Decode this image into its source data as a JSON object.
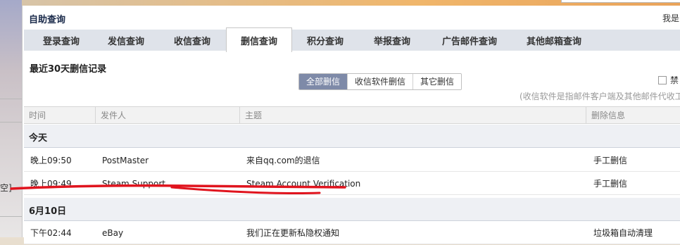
{
  "background": {
    "left_edge_text": "空]"
  },
  "panel": {
    "title": "自助查询",
    "right_note": "我是"
  },
  "tabs": [
    {
      "label": "登录查询",
      "active": false
    },
    {
      "label": "发信查询",
      "active": false
    },
    {
      "label": "收信查询",
      "active": false
    },
    {
      "label": "删信查询",
      "active": true
    },
    {
      "label": "积分查询",
      "active": false
    },
    {
      "label": "举报查询",
      "active": false
    },
    {
      "label": "广告邮件查询",
      "active": false
    },
    {
      "label": "其他邮箱查询",
      "active": false
    }
  ],
  "section": {
    "title": "最近30天删信记录"
  },
  "filters": {
    "buttons": [
      {
        "label": "全部删信",
        "active": true
      },
      {
        "label": "收信软件删信",
        "active": false
      },
      {
        "label": "其它删信",
        "active": false
      }
    ],
    "checkbox_label": "禁",
    "hint": "(收信软件是指邮件客户端及其他邮件代收工"
  },
  "table": {
    "columns": [
      "时间",
      "发件人",
      "主题",
      "删除信息"
    ],
    "groups": [
      {
        "label": "今天",
        "rows": [
          {
            "time": "晚上09:50",
            "sender": "PostMaster",
            "subject": "来自qq.com的退信",
            "info": "手工删信"
          },
          {
            "time": "晚上09:49",
            "sender": "Steam Support",
            "subject": "Steam Account Verification",
            "info": "手工删信"
          }
        ]
      },
      {
        "label": "6月10日",
        "rows": [
          {
            "time": "下午02:44",
            "sender": "eBay",
            "subject": "我们正在更新私隐权通知",
            "info": "垃圾箱自动清理"
          }
        ]
      }
    ]
  },
  "colors": {
    "accent": "#7e8aa8",
    "annotation_red": "#e0141e",
    "tabbar_bg": "#dfe3ea",
    "group_bg": "#eef0f4"
  }
}
